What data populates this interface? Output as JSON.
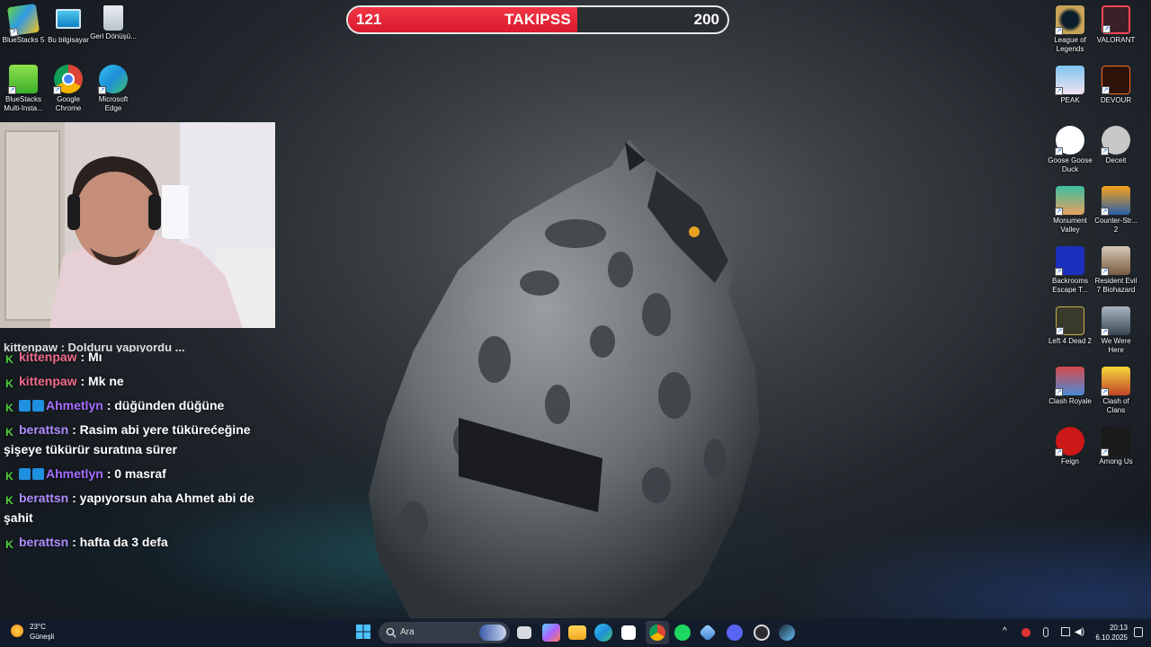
{
  "goal": {
    "current": "121",
    "title": "TAKIPSS",
    "target": "200",
    "progress": 0.605
  },
  "desktop_left": [
    {
      "label": "BlueStacks 5",
      "icon": "bluestacks-icon"
    },
    {
      "label": "Bu bilgisayar",
      "icon": "computer-icon"
    },
    {
      "label": "Geri Dönüşü...",
      "icon": "recycle-bin-icon"
    },
    {
      "label": "BlueStacks Multi-Insta...",
      "icon": "bluestacks-multi-icon"
    },
    {
      "label": "Google Chrome",
      "icon": "chrome-icon"
    },
    {
      "label": "Microsoft Edge",
      "icon": "edge-icon"
    }
  ],
  "desktop_right": [
    {
      "label": "League of Legends",
      "icon": "league-icon"
    },
    {
      "label": "VALORANT",
      "icon": "valorant-icon"
    },
    {
      "label": "PEAK",
      "icon": "peak-icon"
    },
    {
      "label": "DEVOUR",
      "icon": "devour-icon"
    },
    {
      "label": "Goose Goose Duck",
      "icon": "goose-icon"
    },
    {
      "label": "Deceit",
      "icon": "deceit-icon"
    },
    {
      "label": "Monument Valley",
      "icon": "monument-icon"
    },
    {
      "label": "Counter-Str... 2",
      "icon": "cs2-icon"
    },
    {
      "label": "Backrooms Escape T...",
      "icon": "backrooms-icon"
    },
    {
      "label": "Resident Evil 7 Biohazard",
      "icon": "re7-icon"
    },
    {
      "label": "Left 4 Dead 2",
      "icon": "l4d2-icon"
    },
    {
      "label": "We Were Here",
      "icon": "we-were-here-icon"
    },
    {
      "label": "Clash Royale",
      "icon": "clash-royale-icon"
    },
    {
      "label": "Clash of Clans",
      "icon": "clash-of-clans-icon"
    },
    {
      "label": "Feign",
      "icon": "feign-icon"
    },
    {
      "label": "Among Us",
      "icon": "among-us-icon"
    }
  ],
  "chat": {
    "cut_off": "kittenpaw : Dolduru yapıyordu ...",
    "messages": [
      {
        "user": "kittenpaw",
        "text": ": Mı",
        "color": "#f36a8a",
        "badges": [
          "k"
        ]
      },
      {
        "user": "kittenpaw",
        "text": ": Mk ne",
        "color": "#f36a8a",
        "badges": [
          "k"
        ]
      },
      {
        "user": "Ahmetlyn",
        "text": ": düğünden düğüne",
        "color": "#a56cff",
        "badges": [
          "k",
          "sq",
          "sq"
        ]
      },
      {
        "user": "berattsn",
        "text": ": Rasim abi yere tükürećeğine şişeye tükürür suratına sürer",
        "color": "#b08cff",
        "badges": [
          "k"
        ]
      },
      {
        "user": "Ahmetlyn",
        "text": ": 0 masraf",
        "color": "#a56cff",
        "badges": [
          "k",
          "sq",
          "sq"
        ]
      },
      {
        "user": "berattsn",
        "text": ": yapıyorsun aha Ahmet abi de şahit",
        "color": "#b08cff",
        "badges": [
          "k"
        ]
      },
      {
        "user": "berattsn",
        "text": ": hafta da 3 defa",
        "color": "#b08cff",
        "badges": [
          "k"
        ]
      }
    ]
  },
  "taskbar": {
    "weather_temp": "23°C",
    "weather_desc": "Güneşli",
    "search_placeholder": "Ara",
    "time": "20:13",
    "date": "6.10.2025"
  },
  "colors": {
    "goal_fill": "#e0202f",
    "kick_green": "#53d33a"
  }
}
